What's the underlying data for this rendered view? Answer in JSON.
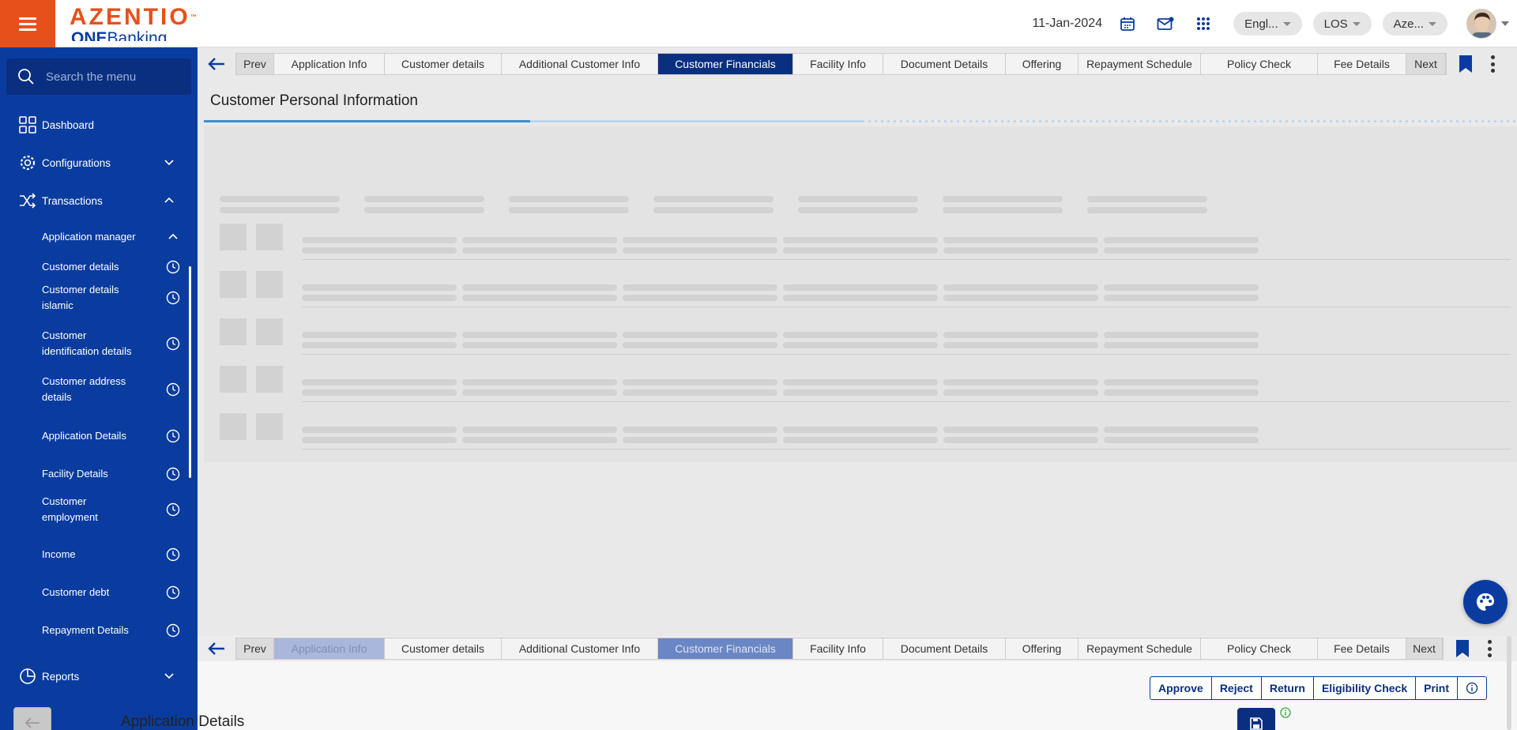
{
  "header": {
    "brand": "AZENTIO",
    "brand_tm": "™",
    "sub_brand_bold": "ONE",
    "sub_brand_rest": "Banking",
    "date": "11-Jan-2024",
    "language": "Engl...",
    "module": "LOS",
    "entity": "Aze..."
  },
  "sidebar": {
    "search_placeholder": "Search the menu",
    "dashboard": "Dashboard",
    "configurations": "Configurations",
    "transactions": "Transactions",
    "application_manager": "Application manager",
    "items": [
      [
        "Customer details"
      ],
      [
        "Customer details",
        "islamic"
      ],
      [
        "Customer",
        "identification details"
      ],
      [
        "Customer address",
        "details"
      ],
      [
        "Application Details"
      ],
      [
        "Facility Details"
      ],
      [
        "Customer",
        "employment"
      ],
      [
        "Income"
      ],
      [
        "Customer debt"
      ],
      [
        "Repayment Details"
      ]
    ],
    "reports": "Reports"
  },
  "tabs": {
    "prev": "Prev",
    "next": "Next",
    "items": [
      "Application Info",
      "Customer details",
      "Additional Customer Info",
      "Customer Financials",
      "Facility Info",
      "Document Details",
      "Offering",
      "Repayment Schedule",
      "Policy Check",
      "Fee Details"
    ],
    "active_index": 3
  },
  "main": {
    "title": "Customer Personal Information"
  },
  "lower": {
    "actions": [
      "Approve",
      "Reject",
      "Return",
      "Eligibility Check",
      "Print"
    ],
    "section_title": "Application Details"
  },
  "colors": {
    "brand_orange": "#e8501b",
    "sidebar_blue": "#0a3ca0",
    "active_tab": "#0a2f80"
  }
}
